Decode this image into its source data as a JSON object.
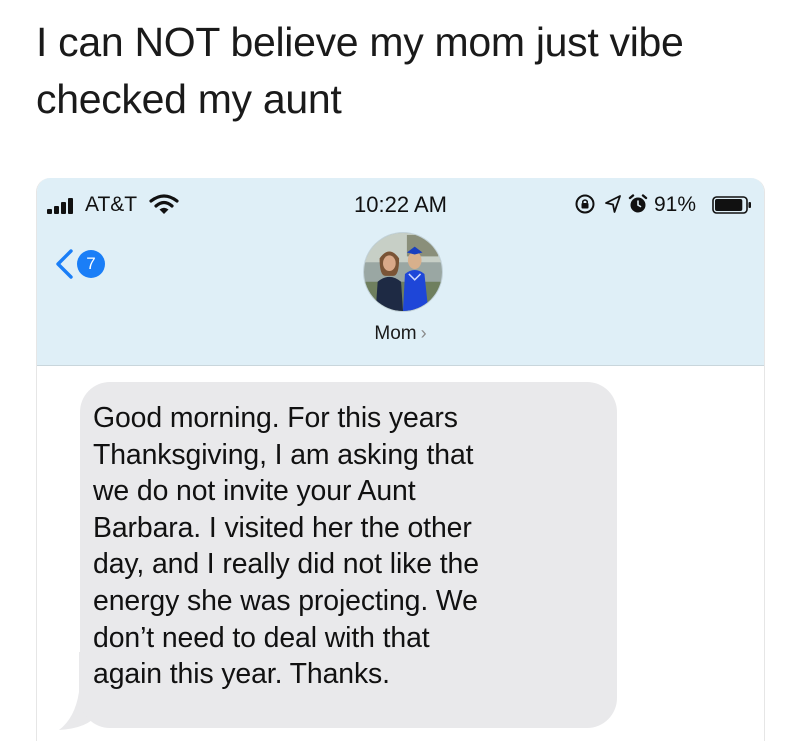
{
  "caption": {
    "line1": "I can NOT believe my mom just vibe",
    "line2": "checked my aunt"
  },
  "status_bar": {
    "carrier": "AT&T",
    "time": "10:22 AM",
    "battery_percent": "91%",
    "battery_level": 0.91,
    "icons": [
      "signal-icon",
      "wifi-icon",
      "rotation-lock-icon",
      "location-icon",
      "alarm-icon",
      "battery-icon"
    ]
  },
  "nav": {
    "back_badge": "7",
    "contact_name": "Mom",
    "contact_chevron": "›"
  },
  "message": {
    "lines": [
      "Good morning. For this years",
      "Thanksgiving, I am asking that",
      "we do not invite your Aunt",
      "Barbara. I visited her the other",
      "day, and I really did not like the",
      "energy she was projecting. We",
      "don’t need to deal with that",
      "again this year. Thanks."
    ]
  },
  "colors": {
    "header_bg": "#dfeff7",
    "bubble_bg": "#e9e9eb",
    "badge_blue": "#1a7ef7"
  }
}
